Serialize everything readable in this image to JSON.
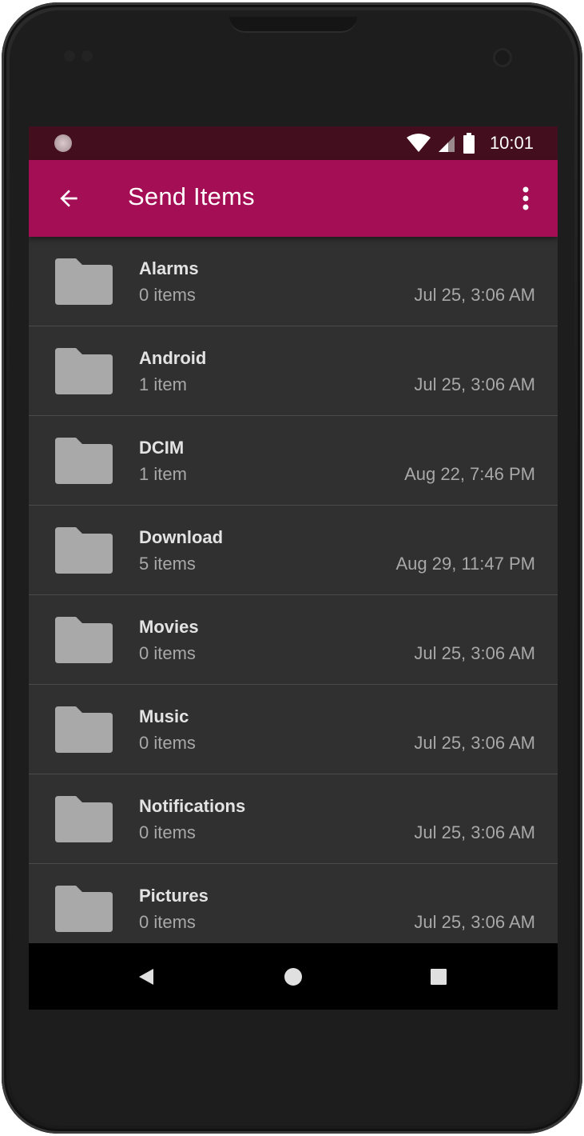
{
  "status_bar": {
    "time": "10:01",
    "icons": [
      "notification-icon",
      "wifi-icon",
      "cell-signal-icon",
      "battery-icon"
    ],
    "background": "#430f1e"
  },
  "app_bar": {
    "title": "Send Items",
    "back_icon": "arrow-back-icon",
    "menu_icon": "more-vert-icon",
    "background": "#a30e55"
  },
  "items": [
    {
      "name": "Alarms",
      "count": "0 items",
      "date": "Jul 25, 3:06 AM"
    },
    {
      "name": "Android",
      "count": "1 item",
      "date": "Jul 25, 3:06 AM"
    },
    {
      "name": "DCIM",
      "count": "1 item",
      "date": "Aug 22, 7:46 PM"
    },
    {
      "name": "Download",
      "count": "5 items",
      "date": "Aug 29, 11:47 PM"
    },
    {
      "name": "Movies",
      "count": "0 items",
      "date": "Jul 25, 3:06 AM"
    },
    {
      "name": "Music",
      "count": "0 items",
      "date": "Jul 25, 3:06 AM"
    },
    {
      "name": "Notifications",
      "count": "0 items",
      "date": "Jul 25, 3:06 AM"
    },
    {
      "name": "Pictures",
      "count": "0 items",
      "date": "Jul 25, 3:06 AM"
    }
  ],
  "nav_bar": {
    "icons": [
      "nav-back-icon",
      "nav-home-icon",
      "nav-recents-icon"
    ]
  },
  "colors": {
    "list_background": "#303030",
    "folder_icon": "#a9a9a9",
    "divider": "#4a4a4a"
  }
}
